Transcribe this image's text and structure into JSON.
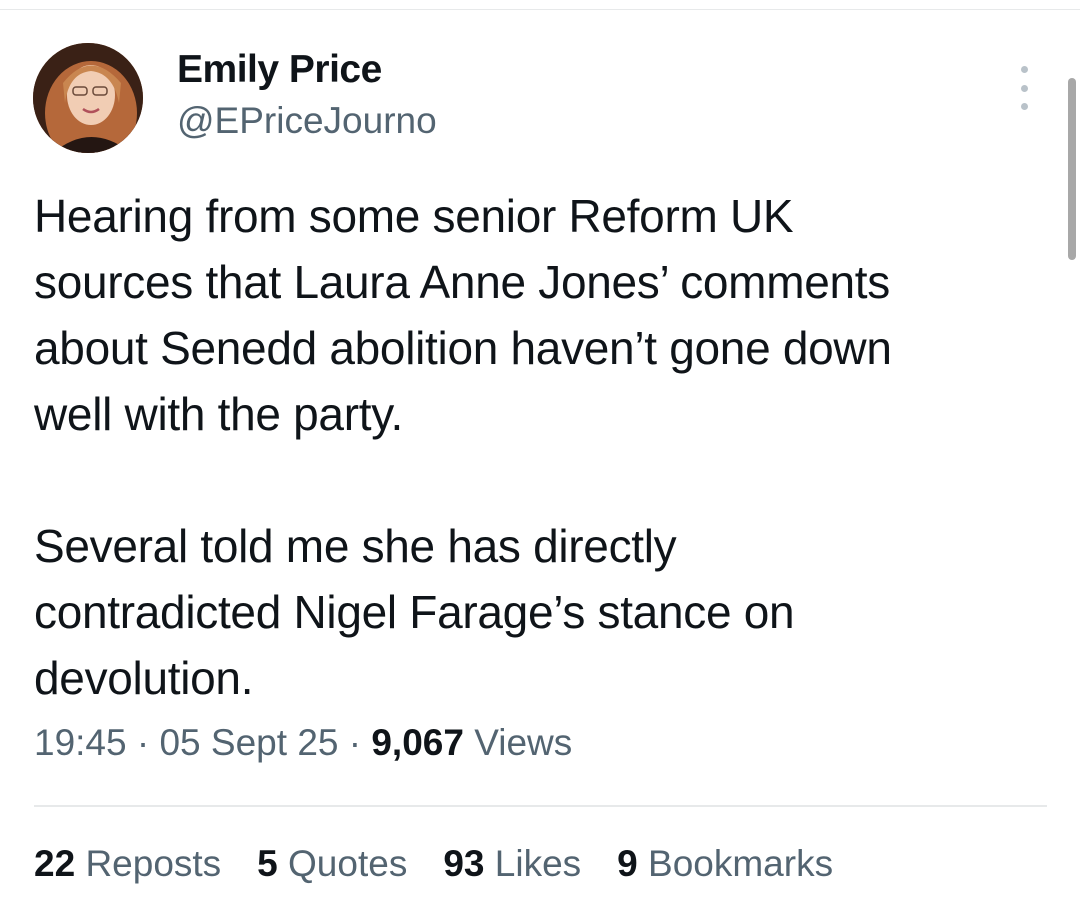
{
  "author": {
    "display_name": "Emily Price",
    "handle": "@EPriceJourno"
  },
  "tweet": {
    "text": "Hearing from some senior Reform UK\nsources that Laura Anne Jones’ comments\nabout Senedd abolition haven’t gone down\nwell with the party.\n\nSeveral told me she has directly\ncontradicted Nigel Farage’s stance on\ndevolution.",
    "time": "19:45",
    "date": "05 Sept 25",
    "separator": "·",
    "views_count": "9,067",
    "views_label": "Views"
  },
  "stats": {
    "reposts": {
      "count": "22",
      "label": "Reposts"
    },
    "quotes": {
      "count": "5",
      "label": "Quotes"
    },
    "likes": {
      "count": "93",
      "label": "Likes"
    },
    "bookmarks": {
      "count": "9",
      "label": "Bookmarks"
    }
  },
  "icons": {
    "more": "more-vertical-icon"
  },
  "colors": {
    "text_primary": "#0f1419",
    "text_secondary": "#536471",
    "divider": "#e7e9ea"
  }
}
